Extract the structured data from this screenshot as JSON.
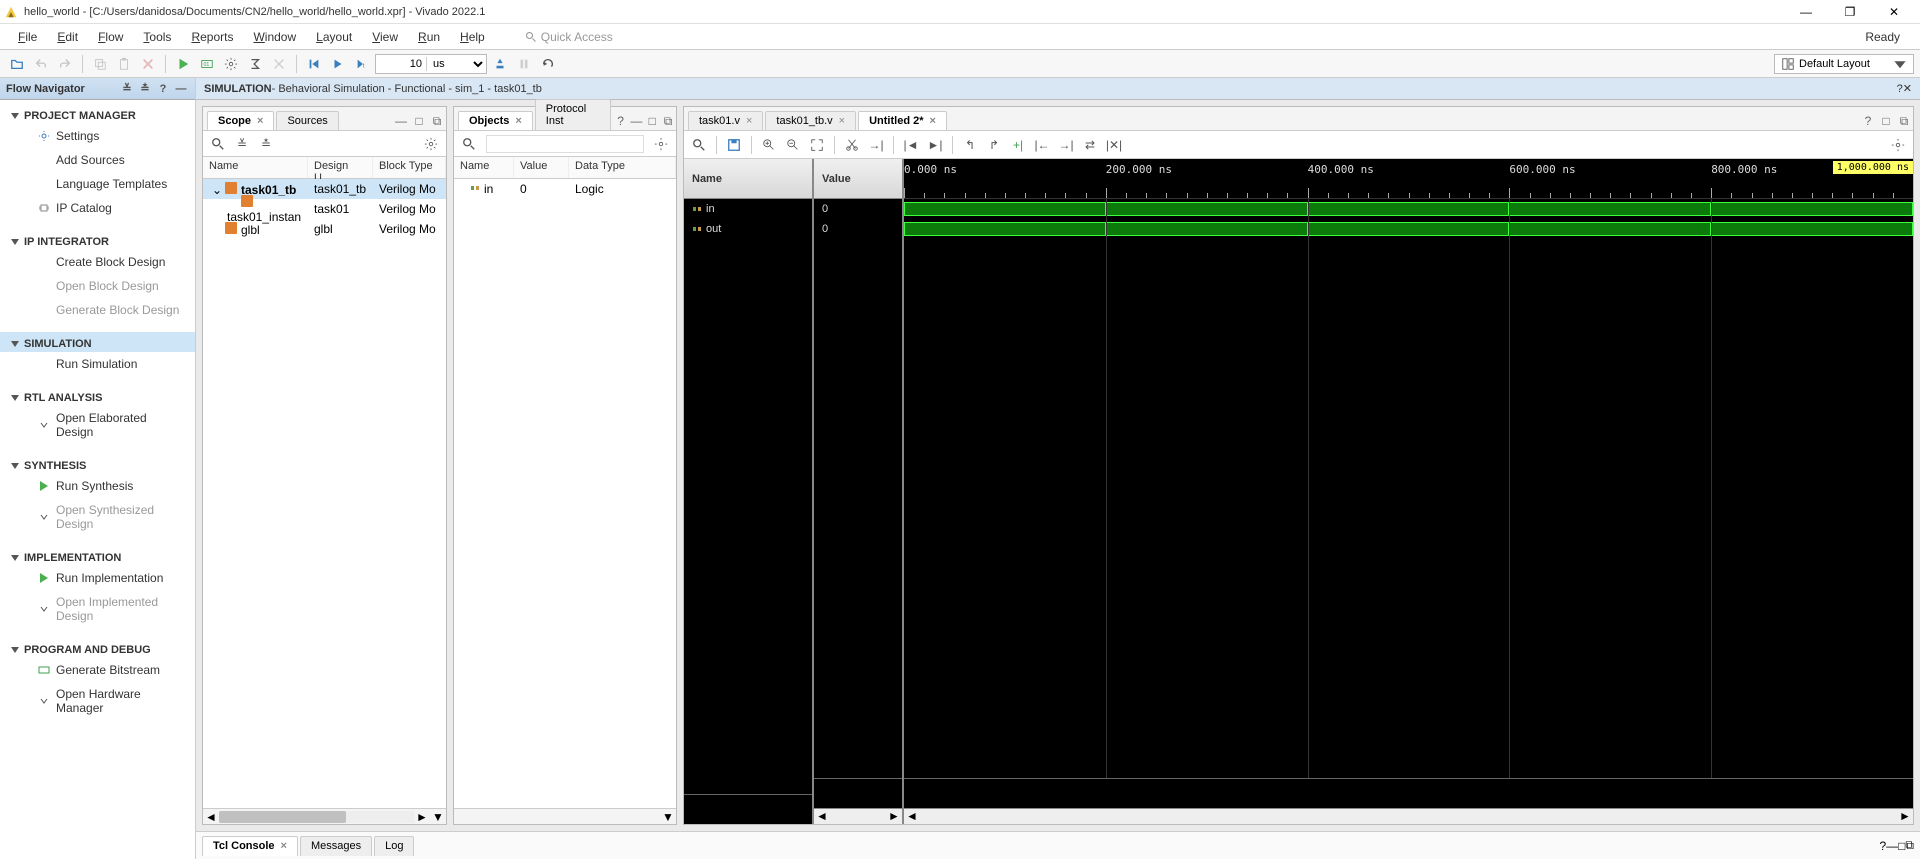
{
  "window_title": "hello_world - [C:/Users/danidosa/Documents/CN2/hello_world/hello_world.xpr] - Vivado 2022.1",
  "menus": [
    "File",
    "Edit",
    "Flow",
    "Tools",
    "Reports",
    "Window",
    "Layout",
    "View",
    "Run",
    "Help"
  ],
  "quick_access_placeholder": "Quick Access",
  "status": "Ready",
  "time_value": "10",
  "time_unit": "us",
  "default_layout": "Default Layout",
  "flow_navigator": {
    "title": "Flow Navigator",
    "sections": [
      {
        "label": "PROJECT MANAGER",
        "items": [
          {
            "label": "Settings",
            "icon": "gear"
          },
          {
            "label": "Add Sources"
          },
          {
            "label": "Language Templates"
          },
          {
            "label": "IP Catalog",
            "icon": "chip"
          }
        ]
      },
      {
        "label": "IP INTEGRATOR",
        "items": [
          {
            "label": "Create Block Design"
          },
          {
            "label": "Open Block Design",
            "disabled": true
          },
          {
            "label": "Generate Block Design",
            "disabled": true
          }
        ]
      },
      {
        "label": "SIMULATION",
        "active": true,
        "items": [
          {
            "label": "Run Simulation"
          }
        ]
      },
      {
        "label": "RTL ANALYSIS",
        "items": [
          {
            "label": "Open Elaborated Design",
            "icon": "chev"
          }
        ]
      },
      {
        "label": "SYNTHESIS",
        "items": [
          {
            "label": "Run Synthesis",
            "icon": "play"
          },
          {
            "label": "Open Synthesized Design",
            "icon": "chev",
            "disabled": true
          }
        ]
      },
      {
        "label": "IMPLEMENTATION",
        "items": [
          {
            "label": "Run Implementation",
            "icon": "play"
          },
          {
            "label": "Open Implemented Design",
            "icon": "chev",
            "disabled": true
          }
        ]
      },
      {
        "label": "PROGRAM AND DEBUG",
        "items": [
          {
            "label": "Generate Bitstream",
            "icon": "bits"
          },
          {
            "label": "Open Hardware Manager",
            "icon": "chev"
          }
        ]
      }
    ]
  },
  "sim_banner": {
    "title": "SIMULATION",
    "subtitle": " - Behavioral Simulation - Functional - sim_1 - task01_tb"
  },
  "scope": {
    "tabs": [
      "Scope",
      "Sources"
    ],
    "active_tab": 0,
    "columns": [
      "Name",
      "Design U...",
      "Block Type"
    ],
    "rows": [
      {
        "indent": 0,
        "expand": "open",
        "name": "task01_tb",
        "design": "task01_tb",
        "type": "Verilog Mo",
        "selected": true
      },
      {
        "indent": 1,
        "name": "task01_instan",
        "design": "task01",
        "type": "Verilog Mo"
      },
      {
        "indent": 0,
        "name": "glbl",
        "design": "glbl",
        "type": "Verilog Mo"
      }
    ]
  },
  "objects": {
    "tabs": [
      "Objects",
      "Protocol Inst"
    ],
    "active_tab": 0,
    "columns": [
      "Name",
      "Value",
      "Data Type"
    ],
    "rows": [
      {
        "name": "in",
        "value": "0",
        "type": "Logic"
      }
    ]
  },
  "wave": {
    "tabs": [
      "task01.v",
      "task01_tb.v",
      "Untitled 2*"
    ],
    "active_tab": 2,
    "name_header": "Name",
    "value_header": "Value",
    "signals": [
      {
        "name": "in",
        "value": "0"
      },
      {
        "name": "out",
        "value": "0"
      }
    ],
    "ruler_ticks": [
      "0.000 ns",
      "200.000 ns",
      "400.000 ns",
      "600.000 ns",
      "800.000 ns"
    ],
    "cursor_label": "1,000.000 ns",
    "segments": [
      {
        "start_pct": 0,
        "end_pct": 20
      },
      {
        "start_pct": 20,
        "end_pct": 40
      },
      {
        "start_pct": 40,
        "end_pct": 60
      },
      {
        "start_pct": 60,
        "end_pct": 80
      },
      {
        "start_pct": 80,
        "end_pct": 100
      }
    ]
  },
  "console_tabs": [
    "Tcl Console",
    "Messages",
    "Log"
  ],
  "console_active": 0
}
